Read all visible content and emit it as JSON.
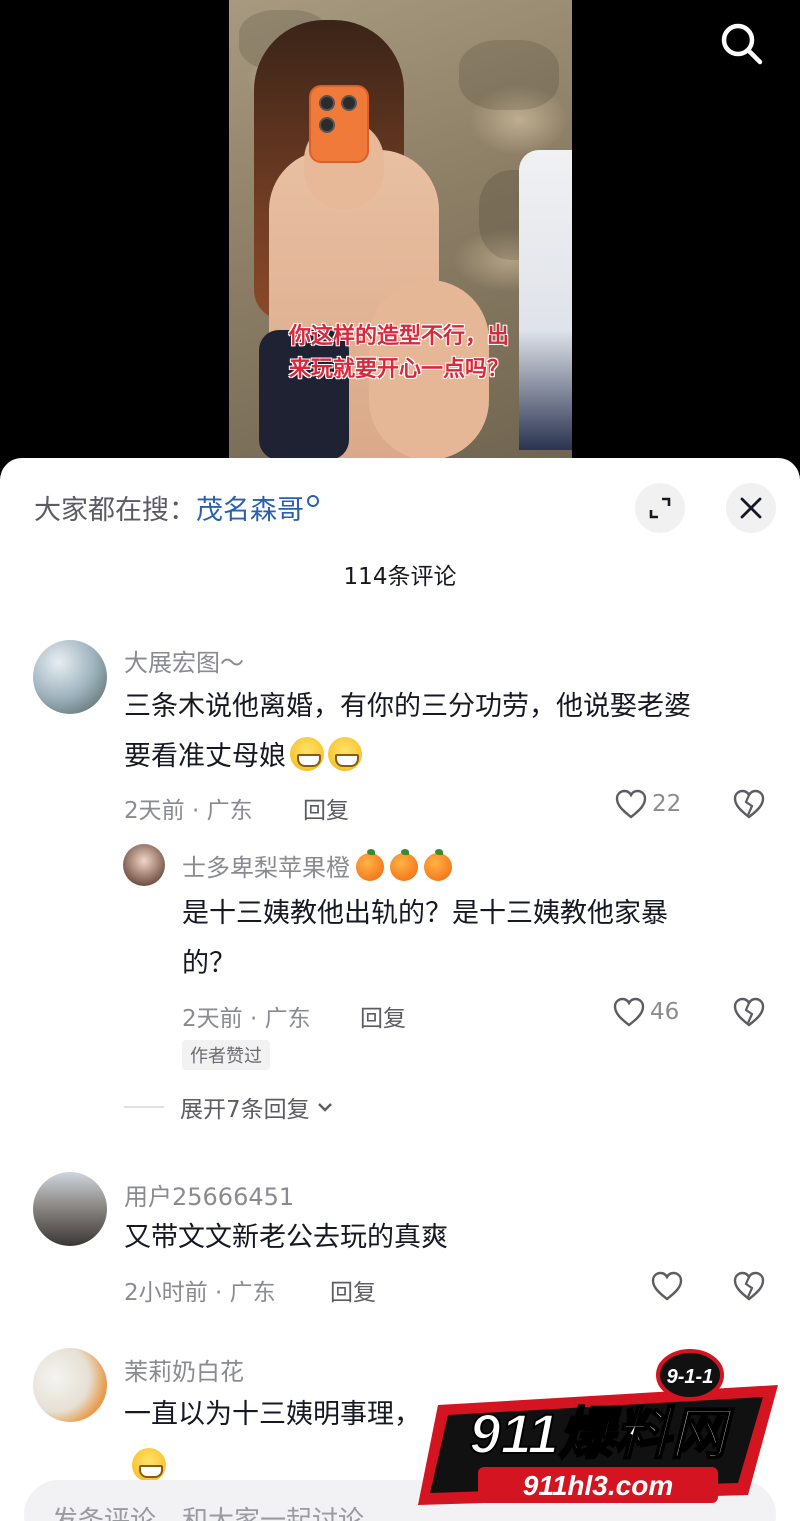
{
  "video": {
    "caption_line1": "你这样的造型不行，出",
    "caption_line2": "来玩就要开心一点吗？"
  },
  "header": {
    "hot_search_prefix": "大家都在搜：",
    "hot_search_term": "茂名森哥",
    "comment_count": "114条评论"
  },
  "comments": [
    {
      "username": "大展宏图～",
      "text_line1": "三条木说他离婚，有你的三分功劳，他说娶老婆",
      "text_line2": "要看准丈母娘",
      "meta": "2天前 · 广东",
      "reply_label": "回复",
      "likes": "22"
    },
    {
      "username": "士多卑梨苹果橙",
      "text_line1": "是十三姨教他出轨的？是十三姨教他家暴",
      "text_line2": "的？",
      "meta": "2天前 · 广东",
      "reply_label": "回复",
      "likes": "46",
      "badge": "作者赞过"
    },
    {
      "username": "用户25666451",
      "text_line1": "又带文文新老公去玩的真爽",
      "meta": "2小时前 · 广东",
      "reply_label": "回复"
    },
    {
      "username": "茉莉奶白花",
      "text_line1": "一直以为十三姨明事理，"
    }
  ],
  "expand_replies": "展开7条回复",
  "input": {
    "placeholder": "发条评论，和大家一起讨论"
  },
  "watermark": {
    "badge": "9-1-1",
    "title": "911爆料网",
    "url": "911hl3.com"
  },
  "colors": {
    "accent_link": "#2a5fb0",
    "caption_red": "#d8283c",
    "watermark_red": "#d41420"
  }
}
